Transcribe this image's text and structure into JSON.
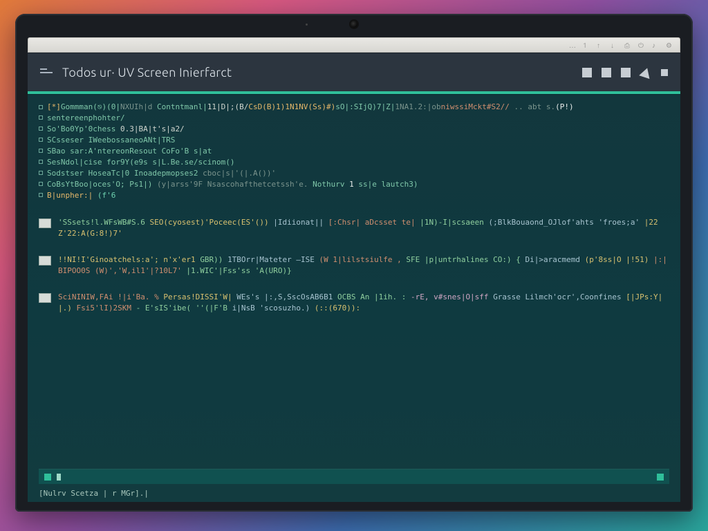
{
  "header": {
    "title": "Todos ur· UV Screen Inierfarct"
  },
  "os": {
    "indicators": [
      "…",
      "1",
      "↑",
      "↓",
      "⎙",
      "⏻",
      "♪",
      "⚙"
    ]
  },
  "top_lines": [
    {
      "bullet": true,
      "segments": [
        {
          "t": "[*]",
          "c": "kw"
        },
        {
          "t": "Gommman(⎋)(0|",
          "c": "id"
        },
        {
          "t": "NXUIh|d",
          "c": "fade"
        },
        {
          "t": " Contntmanl|",
          "c": "id"
        },
        {
          "t": "11|D|;(B/",
          "c": "num"
        },
        {
          "t": "CsD(B)1)1N1NV(Ss)#)",
          "c": "kw"
        },
        {
          "t": "sO|:SIjQ)7|Z|",
          "c": "id"
        },
        {
          "t": "1NA1.2:|ob",
          "c": "fade"
        },
        {
          "t": "niwssiMckt#S2//",
          "c": "g3"
        },
        {
          "t": "   .. abt  s.",
          "c": "fade"
        },
        {
          "t": "(P!)",
          "c": "hi"
        }
      ]
    },
    {
      "bullet": true,
      "segments": [
        {
          "t": "sentereenphohter/",
          "c": "id"
        }
      ]
    },
    {
      "bullet": true,
      "segments": [
        {
          "t": "So'Bo0Yp'0chess   ",
          "c": "id"
        },
        {
          "t": "0.3|BA|t's|a2/",
          "c": "num"
        }
      ]
    },
    {
      "bullet": true,
      "segments": [
        {
          "t": "SCsseser IWeebossaneoANt|TRS",
          "c": "id"
        }
      ]
    },
    {
      "bullet": true,
      "segments": [
        {
          "t": "SBao sar:A'ntereonResout CoFo'B s|at",
          "c": "id"
        }
      ]
    },
    {
      "bullet": true,
      "segments": [
        {
          "t": "SesNdol|cise for9Y(e9s s|L.Be.se/scinom()",
          "c": "id"
        }
      ]
    },
    {
      "bullet": true,
      "segments": [
        {
          "t": "Sodstser HoseaTc|0 Inoadepmopses2  ",
          "c": "id"
        },
        {
          "t": "cboc|s|'(|.A())'",
          "c": "fade"
        }
      ]
    },
    {
      "bullet": true,
      "segments": [
        {
          "t": "CoBsYtBoo|oces'O; Ps1|) ",
          "c": "id"
        },
        {
          "t": "(y|arss'9F Nsascohafthetcetssh'e.  ",
          "c": "fade"
        },
        {
          "t": "Nothurv ",
          "c": "id"
        },
        {
          "t": "1",
          "c": "hi"
        },
        {
          "t": "   ss|e lautch3)",
          "c": "id"
        }
      ]
    },
    {
      "bullet": true,
      "segments": [
        {
          "t": "B|unpher:|   ",
          "c": "kw"
        },
        {
          "t": "(f'6",
          "c": "acc"
        }
      ]
    }
  ],
  "entries": [
    {
      "chip": true,
      "segments": [
        {
          "t": "'SSsets!l.WFsWB#S.6 ",
          "c": "g1"
        },
        {
          "t": "SEO(cyosest)'Poceec(ES'()) ",
          "c": "g2"
        },
        {
          "t": "|Idiionat|| ",
          "c": "g4"
        },
        {
          "t": "[:Chsr| aDcsset te| ",
          "c": "g3"
        },
        {
          "t": "|1N)-I|scsaeen ",
          "c": "g1"
        },
        {
          "t": "(;BlkBouaond_OJlof'ahts 'froes;a' ",
          "c": "g4"
        },
        {
          "t": "|22Z'22:A(G:8!)7'",
          "c": "g2"
        }
      ]
    },
    {
      "chip": true,
      "segments": [
        {
          "t": "!!NI!I'Ginoatchels:a'; n'x'er1 ",
          "c": "g2"
        },
        {
          "t": "GBR)) ",
          "c": "g1"
        },
        {
          "t": "1TBOrr|Mateter –ISE ",
          "c": "g4"
        },
        {
          "t": "(W 1|lilstsiulfe ,",
          "c": "g3"
        },
        {
          "t": " SFE |p|untrhalines  CO:) { ",
          "c": "g1"
        },
        {
          "t": "Di|>aracmemd  ",
          "c": "g4"
        },
        {
          "t": "(p'8ss|O  |!51) ",
          "c": "g2"
        },
        {
          "t": "|:|BIPOO0S (W)','W,il1'|?10L7'",
          "c": "g3"
        },
        {
          "t": "  |1.WIC'|Fss'ss 'A(URO)}",
          "c": "g1"
        }
      ]
    },
    {
      "chip": true,
      "segments": [
        {
          "t": "SciNINIW,FAi !|i'Ba. % ",
          "c": "g3"
        },
        {
          "t": "Persas!DISSI'W| ",
          "c": "g2"
        },
        {
          "t": "WEs's |:,S,SscOsAB6B1  ",
          "c": "g4"
        },
        {
          "t": "OCBS An  |1ih. : ",
          "c": "g1"
        },
        {
          "t": "-rE, v#snes|O|sff   ",
          "c": "g5"
        },
        {
          "t": "Grasse Lilmch'ocr',Coonfines  ",
          "c": "g4"
        },
        {
          "t": "[|JPs:Y||.)  ",
          "c": "g2"
        },
        {
          "t": "Fsi5'lI)2SKM",
          "c": "g3"
        },
        {
          "t": "   -  E'sIS'ibe(  ''(|F'B   ",
          "c": "g1"
        },
        {
          "t": "i|NsB 'scosuzho.)   ",
          "c": "g4"
        },
        {
          "t": "(::(670)):",
          "c": "g2"
        }
      ]
    }
  ],
  "status": {
    "left_text": "",
    "prompt": "[Nulrv Scetza | r MGr].|"
  }
}
